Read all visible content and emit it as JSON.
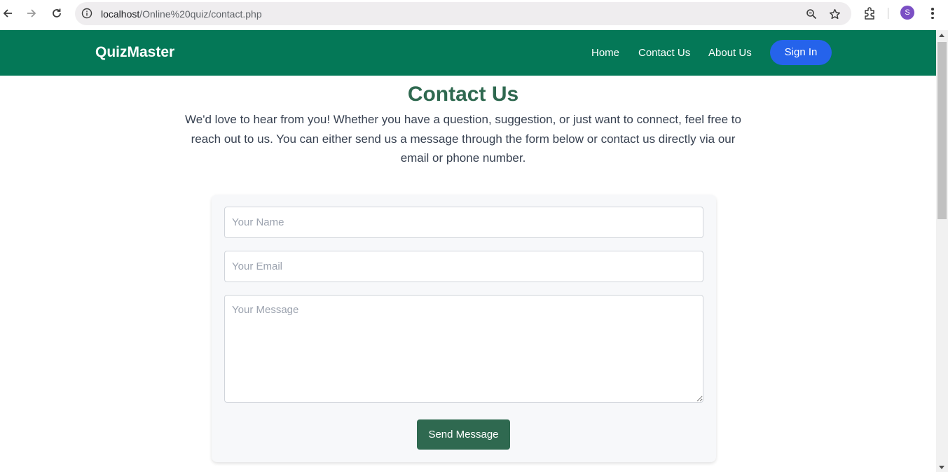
{
  "browser": {
    "url_host": "localhost",
    "url_path": "/Online%20quiz/contact.php",
    "profile_initial": "S"
  },
  "navbar": {
    "brand": "QuizMaster",
    "links": [
      "Home",
      "Contact Us",
      "About Us"
    ],
    "signin_label": "Sign In",
    "color": "#047857",
    "signin_color": "#2563eb"
  },
  "main": {
    "heading": "Contact Us",
    "intro": "We'd love to hear from you! Whether you have a question, suggestion, or just want to connect, feel free to reach out to us. You can either send us a message through the form below or contact us directly via our email or phone number.",
    "form": {
      "name_placeholder": "Your Name",
      "email_placeholder": "Your Email",
      "message_placeholder": "Your Message",
      "submit_label": "Send Message"
    }
  }
}
